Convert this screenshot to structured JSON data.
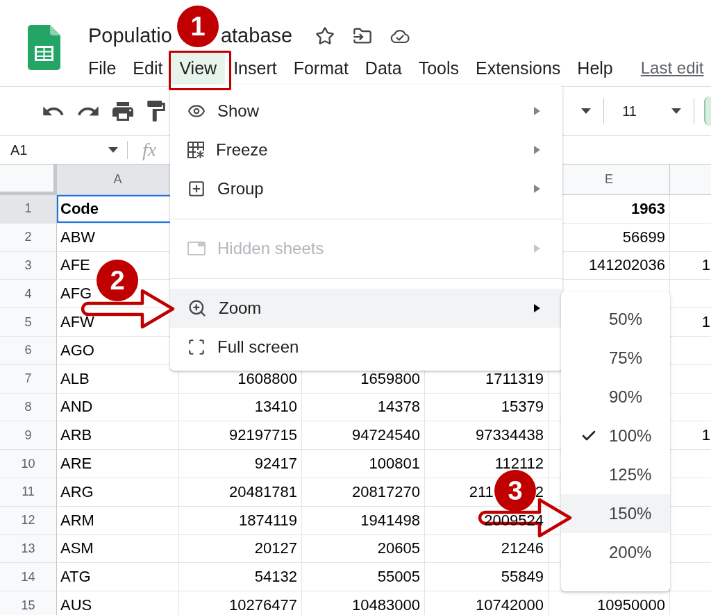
{
  "header": {
    "title_visible_parts": [
      "Populatio",
      "atabase"
    ],
    "menus": [
      {
        "label": "File",
        "selected": false
      },
      {
        "label": "Edit",
        "selected": false
      },
      {
        "label": "View",
        "selected": true
      },
      {
        "label": "Insert",
        "selected": false
      },
      {
        "label": "Format",
        "selected": false
      },
      {
        "label": "Data",
        "selected": false
      },
      {
        "label": "Tools",
        "selected": false
      },
      {
        "label": "Extensions",
        "selected": false
      },
      {
        "label": "Help",
        "selected": false
      }
    ],
    "last_edit": "Last edit"
  },
  "toolbar": {
    "font_size": "11"
  },
  "formula_bar": {
    "cell_reference": "A1",
    "function_label": "fx"
  },
  "sheet": {
    "columns": [
      {
        "label": "A",
        "selected": true
      },
      null,
      null,
      null,
      {
        "label": "E",
        "selected": false
      },
      {
        "selected": false
      }
    ],
    "rows": [
      {
        "number": "1",
        "kind": "header",
        "selected": true,
        "cells": [
          "Code",
          null,
          null,
          null,
          "1963",
          null
        ]
      },
      {
        "number": "2",
        "kind": "data",
        "selected": false,
        "cells": [
          "ABW",
          null,
          null,
          null,
          "56699",
          null
        ]
      },
      {
        "number": "3",
        "kind": "data",
        "selected": false,
        "cells": [
          "AFE",
          null,
          null,
          null,
          "141202036",
          "1"
        ]
      },
      {
        "number": "4",
        "kind": "data",
        "selected": false,
        "cells": [
          "AFG",
          null,
          null,
          null,
          null,
          null
        ]
      },
      {
        "number": "5",
        "kind": "data",
        "selected": false,
        "cells": [
          "AFW",
          null,
          null,
          null,
          null,
          "1"
        ]
      },
      {
        "number": "6",
        "kind": "data",
        "selected": false,
        "cells": [
          "AGO",
          null,
          null,
          null,
          null,
          null
        ]
      },
      {
        "number": "7",
        "kind": "data",
        "selected": false,
        "cells": [
          "ALB",
          "1608800",
          "1659800",
          "1711319",
          null,
          null
        ]
      },
      {
        "number": "8",
        "kind": "data",
        "selected": false,
        "cells": [
          "AND",
          "13410",
          "14378",
          "15379",
          null,
          null
        ]
      },
      {
        "number": "9",
        "kind": "data",
        "selected": false,
        "cells": [
          "ARB",
          "92197715",
          "94724540",
          "97334438",
          null,
          "1"
        ]
      },
      {
        "number": "10",
        "kind": "data",
        "selected": false,
        "cells": [
          "ARE",
          "92417",
          "100801",
          "112112",
          null,
          null
        ]
      },
      {
        "number": "11",
        "kind": "data",
        "selected": false,
        "cells": [
          "ARG",
          "20481781",
          "20817270",
          [
            "211",
            "2"
          ],
          null,
          null
        ]
      },
      {
        "number": "12",
        "kind": "data",
        "selected": false,
        "cells": [
          "ARM",
          "1874119",
          "1941498",
          "2009524",
          null,
          null
        ]
      },
      {
        "number": "13",
        "kind": "data",
        "selected": false,
        "cells": [
          "ASM",
          "20127",
          "20605",
          "21246",
          null,
          null
        ]
      },
      {
        "number": "14",
        "kind": "data",
        "selected": false,
        "cells": [
          "ATG",
          "54132",
          "55005",
          "55849",
          null,
          null
        ]
      },
      {
        "number": "15",
        "kind": "data",
        "selected": false,
        "cells": [
          "AUS",
          "10276477",
          "10483000",
          "10742000",
          "10950000",
          null
        ]
      }
    ]
  },
  "view_menu": {
    "items": [
      {
        "kind": "item",
        "label": "Show",
        "submenu": true,
        "disabled": false,
        "expanded": false
      },
      {
        "kind": "item",
        "label": "Freeze",
        "submenu": true,
        "disabled": false,
        "expanded": false
      },
      {
        "kind": "item",
        "label": "Group",
        "submenu": true,
        "disabled": false,
        "expanded": false
      },
      {
        "kind": "divider"
      },
      {
        "kind": "item",
        "label": "Hidden sheets",
        "submenu": true,
        "disabled": true,
        "expanded": false
      },
      {
        "kind": "divider"
      },
      {
        "kind": "item",
        "label": "Zoom",
        "submenu": true,
        "disabled": false,
        "expanded": true
      },
      {
        "kind": "item",
        "label": "Full screen",
        "submenu": false,
        "disabled": false,
        "expanded": false
      }
    ]
  },
  "zoom_submenu": {
    "items": [
      {
        "label": "50%",
        "checked": false,
        "hovered": false
      },
      {
        "label": "75%",
        "checked": false,
        "hovered": false
      },
      {
        "label": "90%",
        "checked": false,
        "hovered": false
      },
      {
        "label": "100%",
        "checked": true,
        "hovered": false
      },
      {
        "label": "125%",
        "checked": false,
        "hovered": false
      },
      {
        "label": "150%",
        "checked": false,
        "hovered": true
      },
      {
        "label": "200%",
        "checked": false,
        "hovered": false
      }
    ]
  },
  "annotations": [
    {
      "kind": "badge",
      "label": "1"
    },
    {
      "kind": "frame"
    },
    {
      "kind": "badge",
      "label": "2"
    },
    {
      "kind": "arrow"
    },
    {
      "kind": "badge",
      "label": "3"
    },
    {
      "kind": "arrow"
    }
  ]
}
